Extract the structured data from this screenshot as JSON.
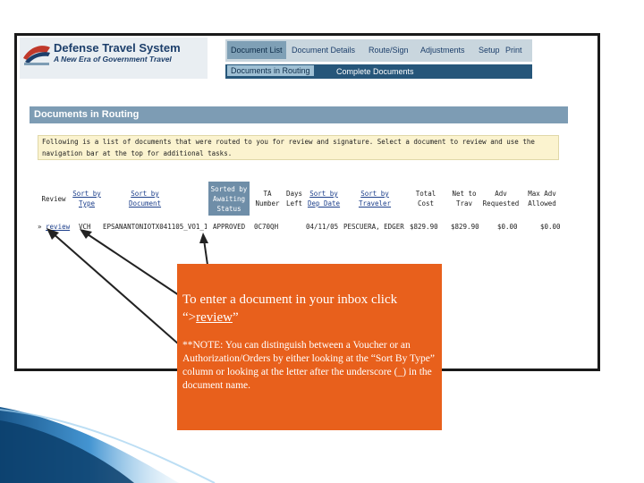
{
  "header": {
    "logo_title": "Defense Travel System",
    "logo_subtitle": "A New Era of Government Travel",
    "nav_top": [
      "Document List",
      "Document Details",
      "Route/Sign",
      "Adjustments",
      "Setup",
      "Print"
    ],
    "nav_sub": [
      "Documents in Routing",
      "Complete Documents"
    ]
  },
  "panel": {
    "title": "Documents in Routing",
    "instructions": "Following is a list of documents that were routed to you for review and signature. Select a document to review and use the navigation bar at the top for additional tasks."
  },
  "table": {
    "headers": {
      "review": "Review",
      "type_line1": "Sort by",
      "type_line2": "Type",
      "document_line1": "Sort by",
      "document_line2": "Document",
      "status_line1": "Sorted by",
      "status_line2": "Awaiting",
      "status_line3": "Status",
      "ta_line1": "TA",
      "ta_line2": "Number",
      "days_line1": "Days",
      "days_line2": "Left",
      "depdate_line1": "Sort by",
      "depdate_line2": "Dep Date",
      "traveler_line1": "Sort by",
      "traveler_line2": "Traveler",
      "totalcost_line1": "Total",
      "totalcost_line2": "Cost",
      "nettotrav_line1": "Net to",
      "nettotrav_line2": "Trav",
      "advreq_line1": "Adv",
      "advreq_line2": "Requested",
      "maxadv_line1": "Max Adv",
      "maxadv_line2": "Allowed"
    },
    "row": {
      "review_prefix": "»",
      "review_link": "review",
      "type": "VCH",
      "document": "EPSANANTONIOTX041105_VO1_1",
      "status": "APPROVED",
      "ta_number": "0C70QH",
      "days_left": "",
      "dep_date": "04/11/05",
      "traveler": "PESCUERA, EDGER",
      "total_cost": "$829.90",
      "net_to_trav": "$829.90",
      "adv_requested": "$0.00",
      "max_adv_allowed": "$0.00"
    }
  },
  "callout": {
    "lead_text": "To enter a document in your inbox click “>",
    "lead_link": "review",
    "lead_end": "”",
    "note": "**NOTE: You can distinguish between a Voucher or an Authorization/Orders by either looking at the “Sort By Type” column or looking at the letter after the underscore (_) in the document name.",
    "color": "#e8601c"
  },
  "colors": {
    "nav_sub_bg": "#26567a",
    "panel_title_bg": "#7d9cb4",
    "decor_blue": "#1f6fae"
  }
}
